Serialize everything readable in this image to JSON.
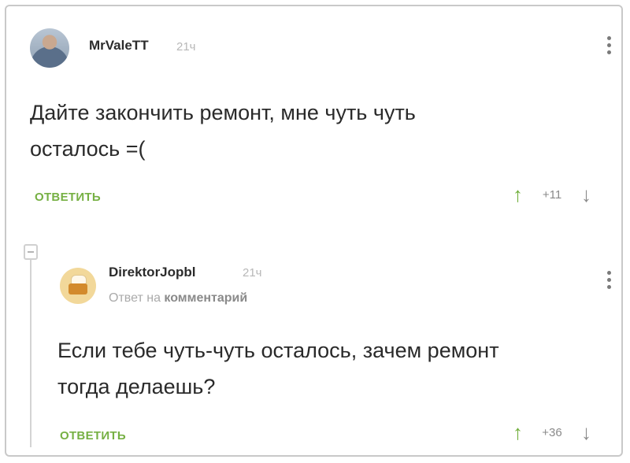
{
  "comments": [
    {
      "author": "MrValeTT",
      "time": "21ч",
      "text": "Дайте закончить ремонт, мне чуть чуть\nосталось =(",
      "reply_label": "ОТВЕТИТЬ",
      "score": "+11",
      "avatar_icon": "user-photo-icon"
    },
    {
      "author": "DirektorJopbl",
      "time": "21ч",
      "reply_to_prefix": "Ответ на",
      "reply_to_target": "комментарий",
      "text": "Если тебе чуть-чуть осталось, зачем ремонт\nтогда делаешь?",
      "reply_label": "ОТВЕТИТЬ",
      "score": "+36",
      "avatar_icon": "chef-avatar-icon"
    }
  ],
  "icons": {
    "upvote": "↑",
    "downvote": "↓",
    "menu": "more-vertical-icon",
    "collapse": "collapse-thread-icon"
  },
  "colors": {
    "accent_green": "#76b043",
    "muted": "#aaaaaa"
  }
}
